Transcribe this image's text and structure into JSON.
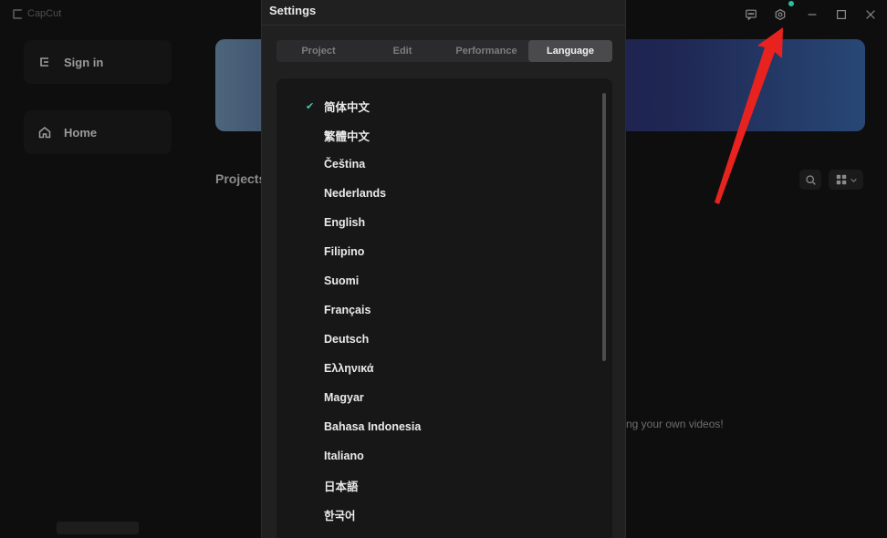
{
  "app": {
    "logo_text": "CapCut"
  },
  "sidebar": {
    "sign_in_label": "Sign in",
    "home_label": "Home"
  },
  "main": {
    "projects_title": "Projects",
    "empty_hint": "ng your own videos!"
  },
  "settings": {
    "title": "Settings",
    "tabs": [
      {
        "label": "Project"
      },
      {
        "label": "Edit"
      },
      {
        "label": "Performance"
      },
      {
        "label": "Language",
        "active": true
      }
    ],
    "selected_language": "简体中文",
    "languages": [
      "简体中文",
      "繁體中文",
      "Čeština",
      "Nederlands",
      "English",
      "Filipino",
      "Suomi",
      "Français",
      "Deutsch",
      "Ελληνικά",
      "Magyar",
      "Bahasa Indonesia",
      "Italiano",
      "日本語",
      "한국어"
    ]
  },
  "colors": {
    "accent_check": "#43c7ad",
    "notification_dot": "#26c1a5",
    "annotation_arrow": "#e8231f"
  },
  "icons": {
    "titlebar": [
      "feedback-icon",
      "gear-icon",
      "minimize-icon",
      "maximize-icon",
      "close-icon"
    ]
  }
}
